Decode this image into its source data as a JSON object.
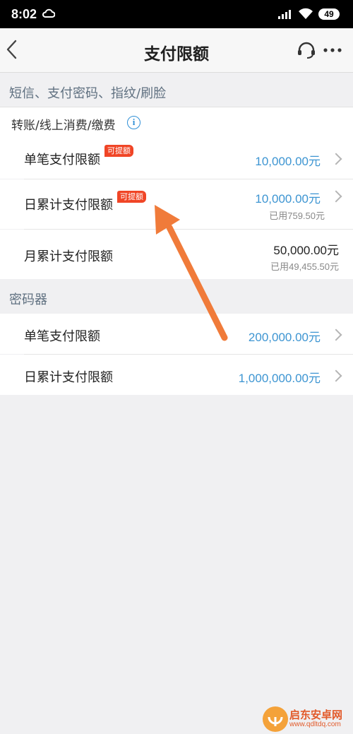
{
  "status_bar": {
    "time": "8:02",
    "battery": "49"
  },
  "nav": {
    "title": "支付限额"
  },
  "sections": {
    "sms": "短信、支付密码、指纹/刷脸",
    "sms_group": "转账/线上消费/缴费",
    "token": "密码器"
  },
  "sms_rows": [
    {
      "label": "单笔支付限额",
      "badge": "可提额",
      "value": "10,000.00元"
    },
    {
      "label": "日累计支付限额",
      "badge": "可提额",
      "value": "10,000.00元",
      "used": "已用759.50元"
    },
    {
      "label": "月累计支付限额",
      "value": "50,000.00元",
      "used": "已用49,455.50元"
    }
  ],
  "token_rows": [
    {
      "label": "单笔支付限额",
      "value": "200,000.00元"
    },
    {
      "label": "日累计支付限额",
      "value": "1,000,000.00元"
    }
  ],
  "watermark": {
    "title": "启东安卓网",
    "url": "www.qdltdq.com"
  },
  "colors": {
    "accent": "#3d95d2",
    "badge": "#f04526",
    "arrow": "#f07b3a"
  }
}
